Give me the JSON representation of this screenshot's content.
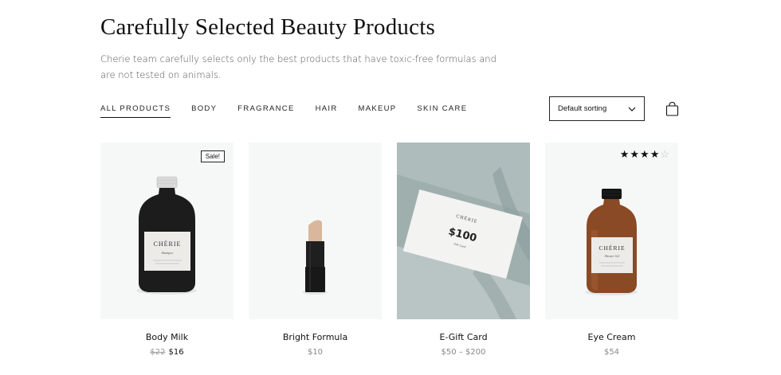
{
  "page": {
    "title": "Carefully Selected Beauty Products",
    "subtitle": "Cherie team carefully selects only the best products that have toxic-free formulas and are not tested on animals."
  },
  "tabs": [
    {
      "label": "ALL PRODUCTS",
      "active": true
    },
    {
      "label": "BODY"
    },
    {
      "label": "FRAGRANCE"
    },
    {
      "label": "HAIR"
    },
    {
      "label": "MAKEUP"
    },
    {
      "label": "SKIN CARE"
    }
  ],
  "sort": {
    "selected": "Default sorting",
    "icon": "chevron-down-icon"
  },
  "cart": {
    "icon": "shopping-bag-icon"
  },
  "products": [
    {
      "name": "Body Milk",
      "price_old": "$22",
      "price": "$16",
      "badge": "Sale!",
      "bottle_brand": "CHÉRIE",
      "bottle_sub": "Shampoo"
    },
    {
      "name": "Bright Formula",
      "price": "$10"
    },
    {
      "name": "E-Gift Card",
      "price": "$50 – $200",
      "card_brand": "CHÉRIE",
      "card_amount": "$100",
      "card_sub": "Gift Card"
    },
    {
      "name": "Eye Cream",
      "price": "$54",
      "rating": 4,
      "rating_max": 5,
      "bottle_brand": "CHÉRIE",
      "bottle_sub": "Shower Gel"
    }
  ],
  "colors": {
    "card_bg": "#f6f8f8",
    "gift_bg": "#9fafae",
    "amber_bottle": "#8a4a26",
    "black_bottle": "#1c1c1c"
  }
}
